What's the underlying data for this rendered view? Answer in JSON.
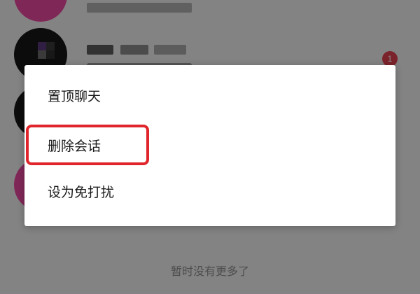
{
  "chat_list": {
    "unread_badge": "1",
    "footer_note": "暂时没有更多了"
  },
  "context_menu": {
    "items": [
      {
        "label": "置顶聊天"
      },
      {
        "label": "删除会话"
      },
      {
        "label": "设为免打扰"
      }
    ],
    "highlighted_item": "删除会话",
    "highlight_color": "#e0262c"
  },
  "colors": {
    "avatar_pink": "#e8479e",
    "badge_red": "#e0404d",
    "dim_overlay": "rgba(0,0,0,0.45)"
  }
}
